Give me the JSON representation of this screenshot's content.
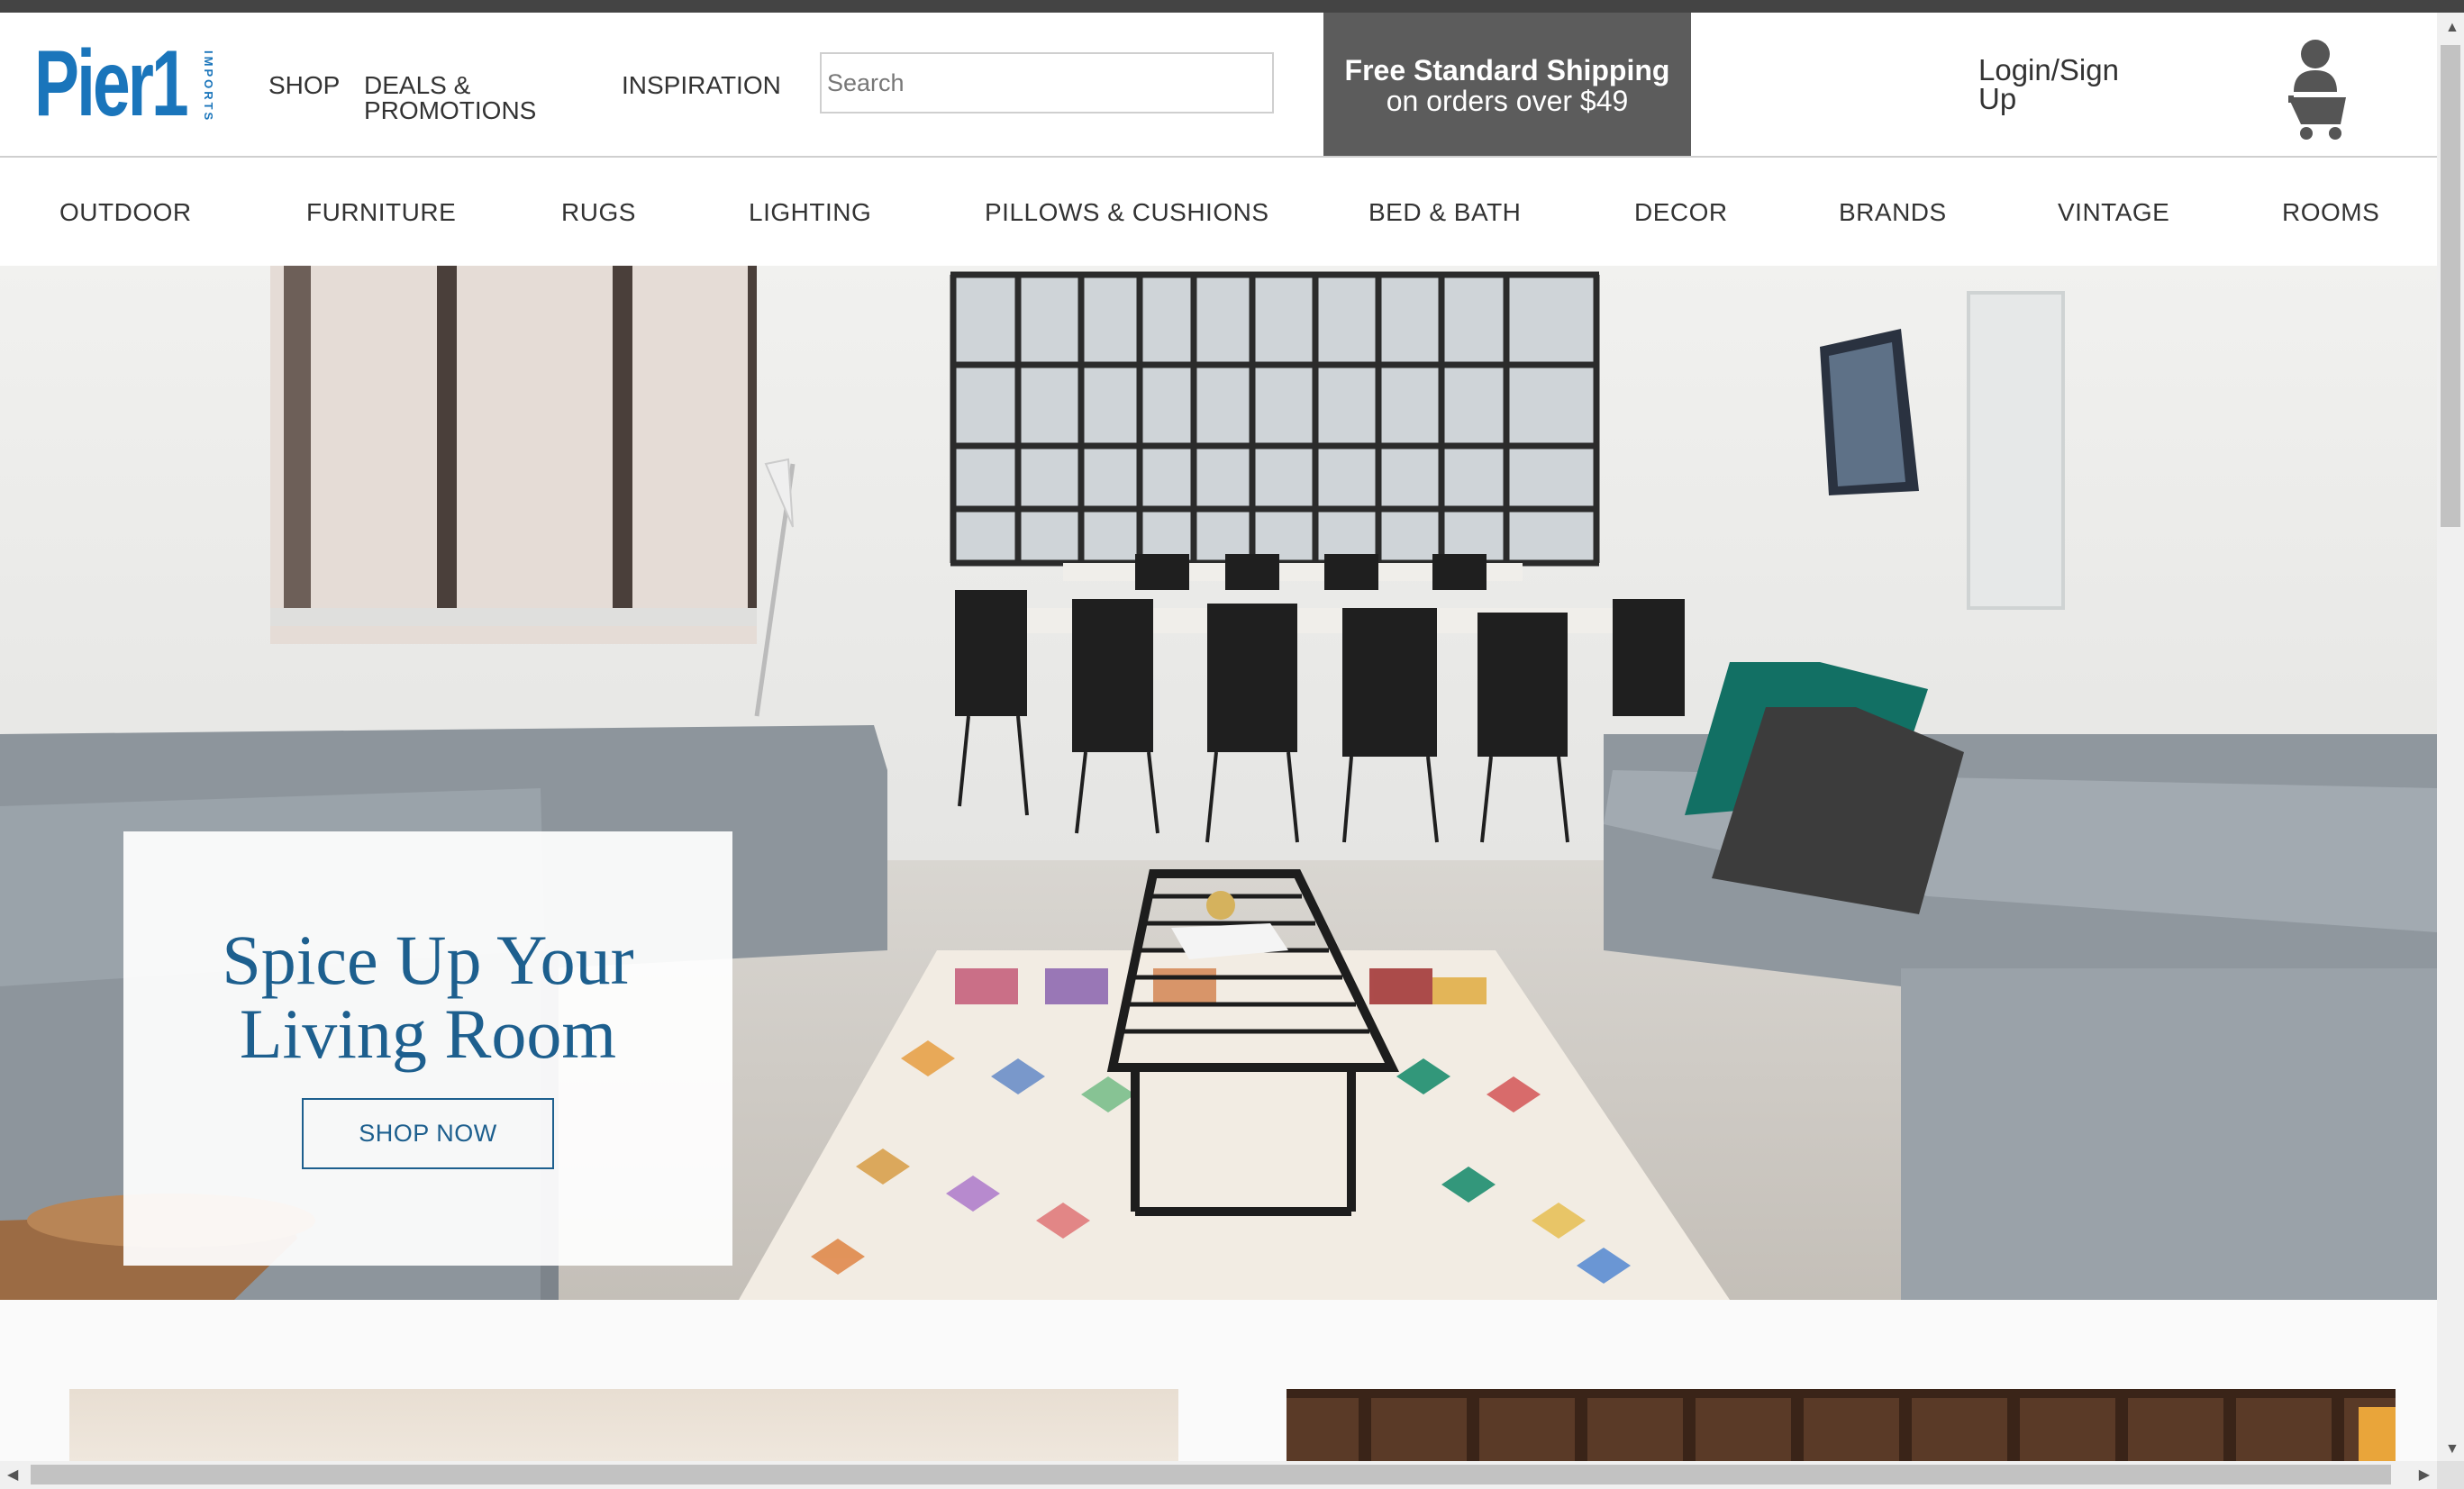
{
  "brand": {
    "logo_text": "Pier1",
    "logo_sub": "IMPORTS",
    "color": "#1a75bb"
  },
  "header": {
    "nav": [
      "SHOP",
      "DEALS & PROMOTIONS",
      "INSPIRATION"
    ],
    "search_placeholder": "Search",
    "promo_line1": "Free Standard Shipping",
    "promo_line2": "on orders over $49",
    "login_label": "Login/Sign Up",
    "cart_icon": "cart-user-icon"
  },
  "categories": [
    "OUTDOOR",
    "FURNITURE",
    "RUGS",
    "LIGHTING",
    "PILLOWS & CUSHIONS",
    "BED & BATH",
    "DECOR",
    "BRANDS",
    "VINTAGE",
    "ROOMS"
  ],
  "hero": {
    "title": "Spice Up Your Living Room",
    "button_label": "SHOP NOW",
    "title_color": "#1d5f8e"
  },
  "scrollbars": {
    "vertical_icons": [
      "scroll-up-arrow-icon",
      "scroll-down-arrow-icon"
    ],
    "horizontal_icons": [
      "scroll-left-arrow-icon",
      "scroll-right-arrow-icon"
    ]
  }
}
